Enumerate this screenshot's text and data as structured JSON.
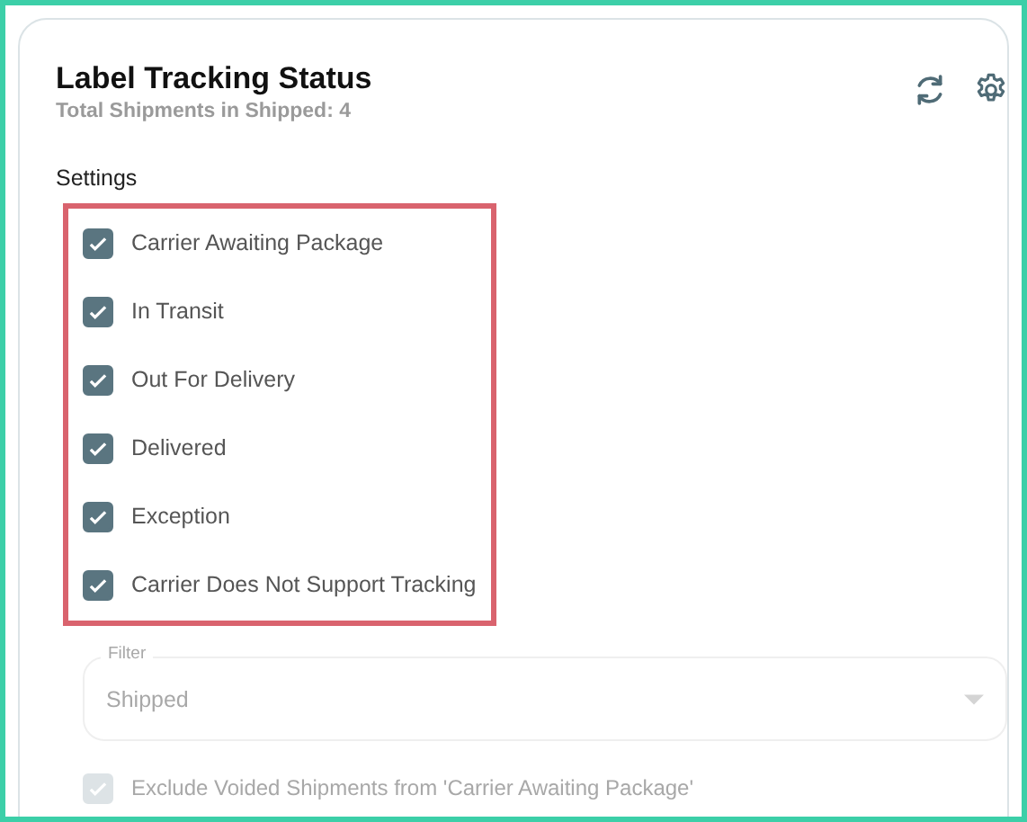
{
  "card": {
    "title": "Label Tracking Status",
    "subtitle": "Total Shipments in Shipped: 4"
  },
  "settings": {
    "label": "Settings",
    "options": [
      {
        "label": "Carrier Awaiting Package",
        "checked": true
      },
      {
        "label": "In Transit",
        "checked": true
      },
      {
        "label": "Out For Delivery",
        "checked": true
      },
      {
        "label": "Delivered",
        "checked": true
      },
      {
        "label": "Exception",
        "checked": true
      },
      {
        "label": "Carrier Does Not Support Tracking",
        "checked": true
      }
    ]
  },
  "filter": {
    "label": "Filter",
    "value": "Shipped",
    "disabled": true
  },
  "exclude_voided": {
    "label": "Exclude Voided Shipments from 'Carrier Awaiting Package'",
    "checked": true,
    "disabled": true
  }
}
